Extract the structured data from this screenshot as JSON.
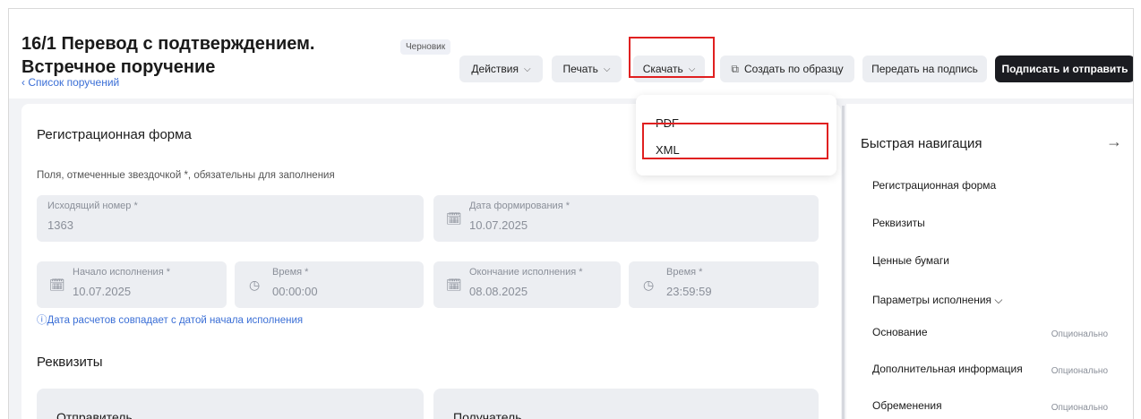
{
  "header": {
    "title_line1": "16/1 Перевод с подтверждением.",
    "title_line2": "Встречное поручение",
    "back_link": "‹ Список поручений",
    "badge": "Черновик"
  },
  "toolbar": {
    "actions": "Действия",
    "print": "Печать",
    "download": "Скачать",
    "create_from_template": "Создать по образцу",
    "send_for_signature": "Передать на подпись",
    "sign_and_send": "Подписать и отправить"
  },
  "dropdown": {
    "items": [
      "PDF",
      "XML"
    ]
  },
  "form": {
    "section_title": "Регистрационная форма",
    "hint": "Поля, отмеченные звездочкой *, обязательны для заполнения",
    "outgoing_number_label": "Исходящий номер *",
    "outgoing_number_value": "1363",
    "formation_date_label": "Дата формирования *",
    "formation_date_value": "10.07.2025",
    "start_label": "Начало исполнения *",
    "start_value": "10.07.2025",
    "start_time_label": "Время *",
    "start_time_value": "00:00:00",
    "end_label": "Окончание исполнения *",
    "end_value": "08.08.2025",
    "end_time_label": "Время *",
    "end_time_value": "23:59:59",
    "info_text": "ⓘДата расчетов совпадает с датой начала исполнения",
    "requisites_title": "Реквизиты",
    "sender_title": "Отправитель",
    "recipient_title": "Получатель"
  },
  "sidebar": {
    "title": "Быстрая навигация",
    "items": [
      {
        "label": "Регистрационная форма",
        "optional": ""
      },
      {
        "label": "Реквизиты",
        "optional": ""
      },
      {
        "label": "Ценные бумаги",
        "optional": ""
      },
      {
        "label": "Параметры исполнения ⌵",
        "optional": ""
      },
      {
        "label": "Основание",
        "optional": "Опционально"
      },
      {
        "label": "Дополнительная информация",
        "optional": "Опционально"
      },
      {
        "label": "Обременения",
        "optional": "Опционально"
      }
    ]
  },
  "colors": {
    "accent_link": "#3b6fd6",
    "highlight": "#e02020",
    "dark_button": "#1b1c21"
  }
}
